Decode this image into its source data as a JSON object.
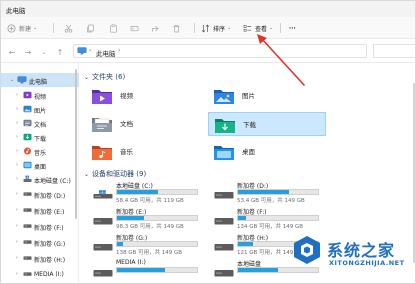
{
  "window": {
    "title": "此电脑"
  },
  "toolbar": {
    "new_label": "新建",
    "sort_label": "排序",
    "view_label": "查看",
    "more_label": "···"
  },
  "address": {
    "path": "此电脑",
    "search_placeholder": ""
  },
  "sidebar": {
    "root": "此电脑",
    "items": [
      {
        "label": "视频",
        "icon": "video-folder-icon"
      },
      {
        "label": "图片",
        "icon": "pictures-folder-icon"
      },
      {
        "label": "文档",
        "icon": "documents-folder-icon"
      },
      {
        "label": "下载",
        "icon": "downloads-folder-icon"
      },
      {
        "label": "音乐",
        "icon": "music-folder-icon"
      },
      {
        "label": "桌面",
        "icon": "desktop-folder-icon"
      },
      {
        "label": "本地磁盘 (C:)",
        "icon": "drive-icon"
      },
      {
        "label": "新加卷 (D:)",
        "icon": "drive-icon"
      },
      {
        "label": "新加卷 (E:)",
        "icon": "drive-icon"
      },
      {
        "label": "新加卷 (F:)",
        "icon": "drive-icon"
      },
      {
        "label": "新加卷 (G:)",
        "icon": "drive-icon"
      },
      {
        "label": "新加卷 (H:)",
        "icon": "drive-icon"
      },
      {
        "label": "MEDIA (I:)",
        "icon": "drive-icon"
      }
    ]
  },
  "folders_group": {
    "header": "文件夹 (6)",
    "items": [
      {
        "name": "视频",
        "icon": "video-folder-icon"
      },
      {
        "name": "图片",
        "icon": "pictures-folder-icon"
      },
      {
        "name": "文档",
        "icon": "documents-folder-icon"
      },
      {
        "name": "下载",
        "icon": "downloads-folder-icon"
      },
      {
        "name": "音乐",
        "icon": "music-folder-icon"
      },
      {
        "name": "桌面",
        "icon": "desktop-folder-icon"
      }
    ]
  },
  "drives_group": {
    "header": "设备和驱动器 (9)",
    "items": [
      {
        "name": "本地磁盘 (C:)",
        "info": "58.4 GB 可用，共 119 GB",
        "used_fraction": 0.51
      },
      {
        "name": "新加卷 (D:)",
        "info": "53.4 GB 可用，共 149 GB",
        "used_fraction": 0.64
      },
      {
        "name": "新加卷 (E:)",
        "info": "98.3 GB 可用，共 149 GB",
        "used_fraction": 0.34
      },
      {
        "name": "新加卷 (F:)",
        "info": "134 GB 可用，共 149 GB",
        "used_fraction": 0.1
      },
      {
        "name": "新加卷 (G:)",
        "info": "138 GB 可用，共 149 GB",
        "used_fraction": 0.07
      },
      {
        "name": "新加卷 (H:)",
        "info": "121 GB 可用，共 149 GB",
        "used_fraction": 0.19
      },
      {
        "name": "MEDIA (I:)",
        "info": "",
        "used_fraction": 0.6
      },
      {
        "name": "本地磁盘",
        "info": "",
        "used_fraction": 0.5
      }
    ]
  },
  "watermark": {
    "title": "系统之家",
    "subtitle": "XITONGZHIJIA.NET"
  },
  "colors": {
    "accent": "#26a0da",
    "selection": "#cce8ff",
    "annotation": "#e0342b",
    "watermark": "#1f6fc2"
  }
}
